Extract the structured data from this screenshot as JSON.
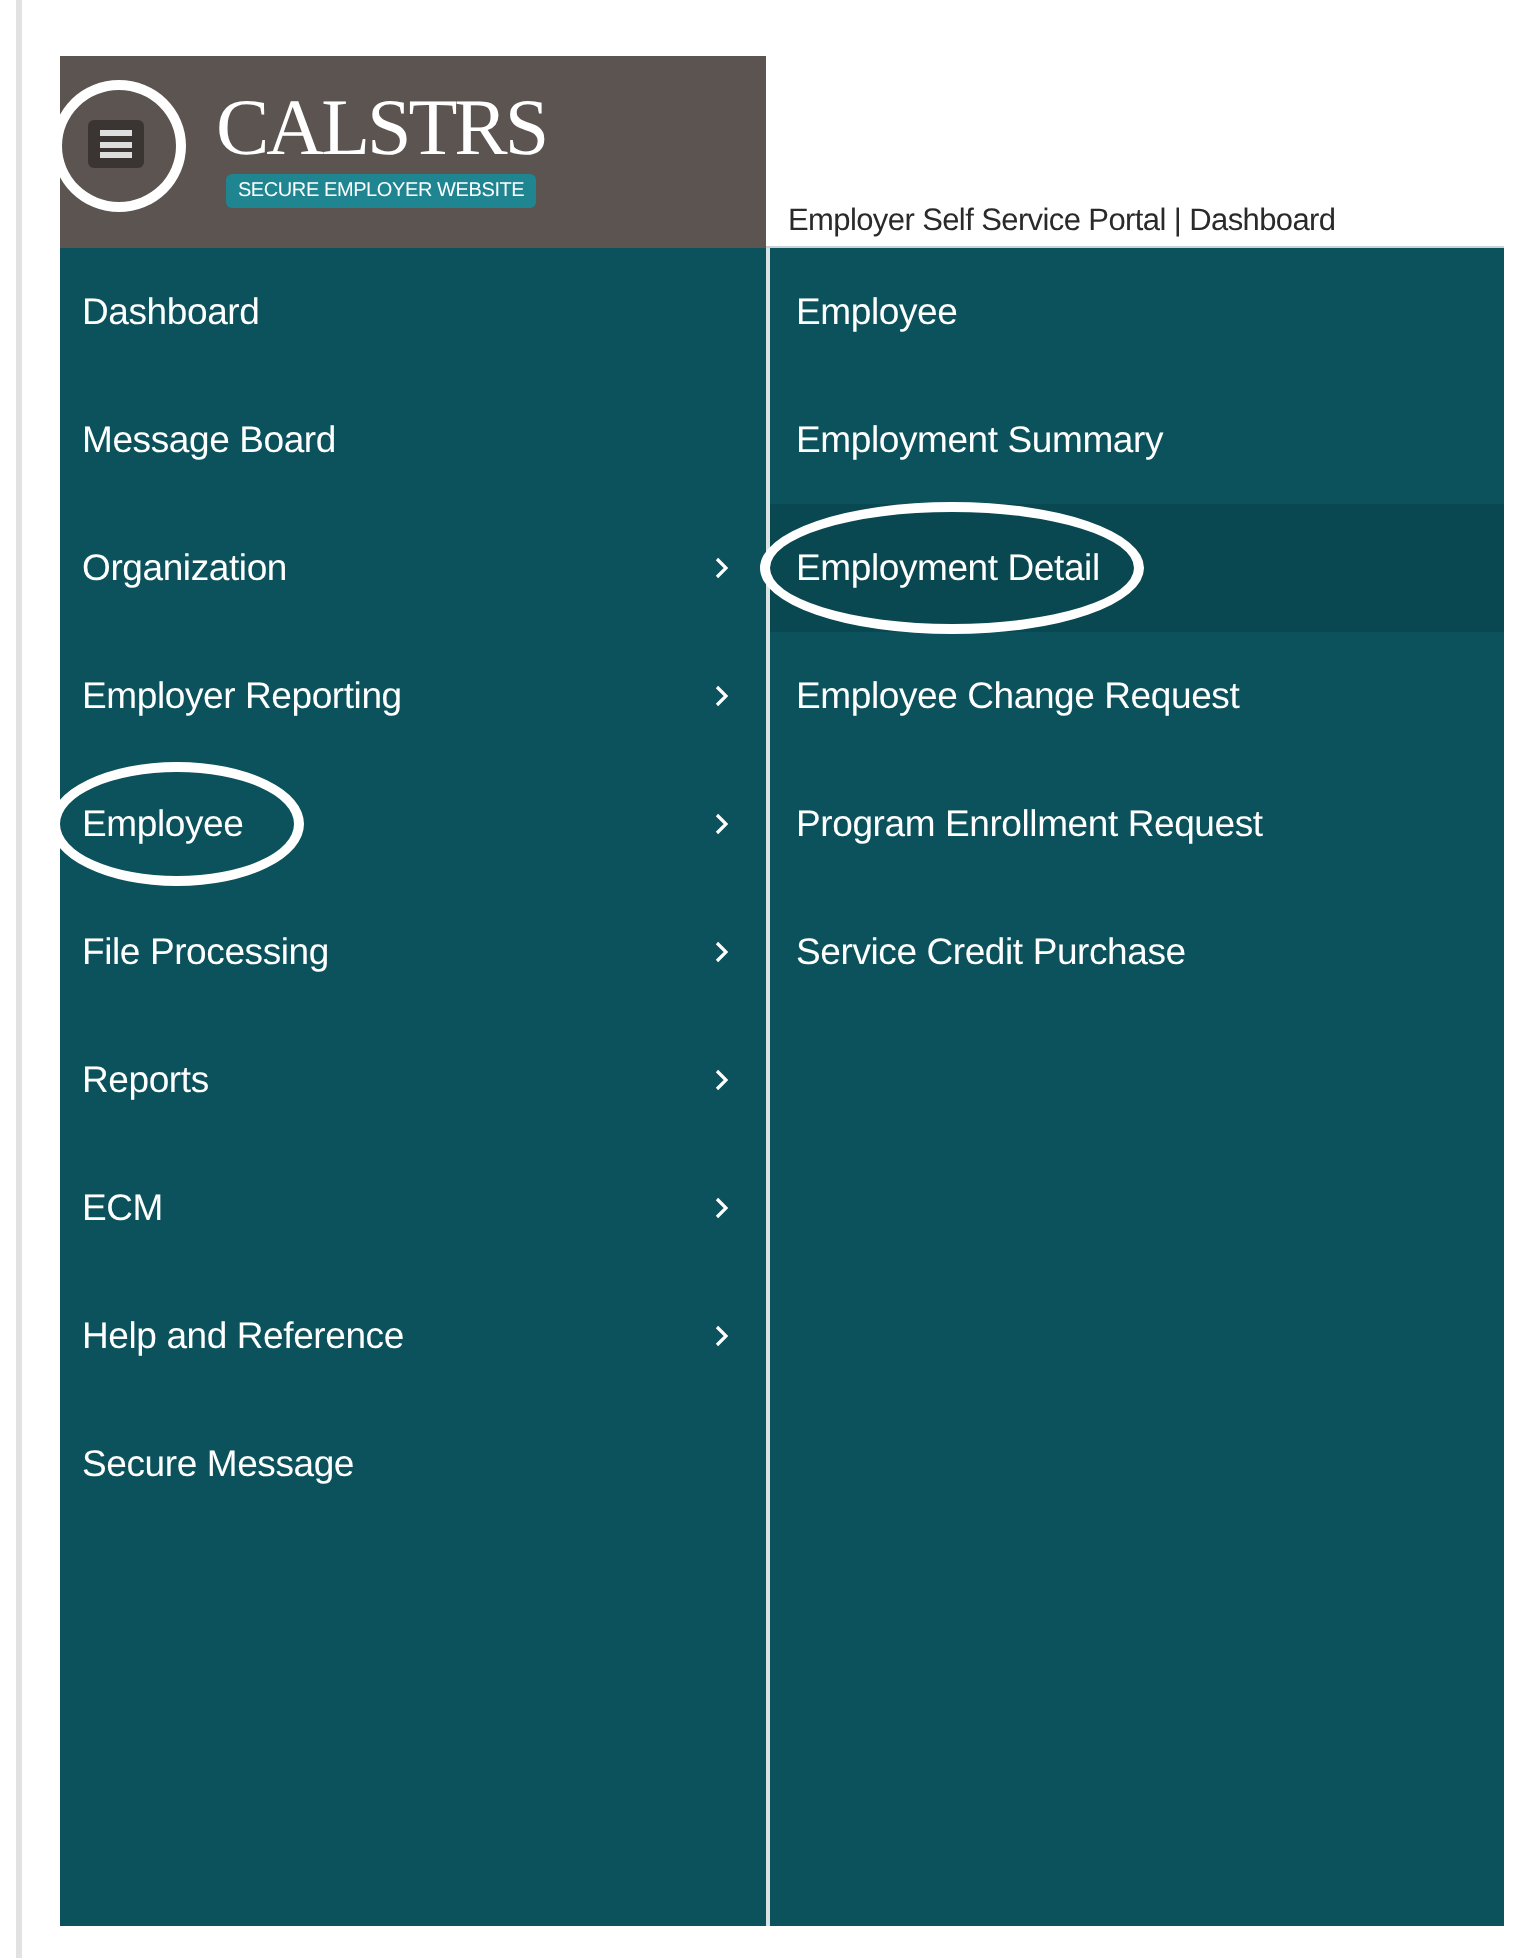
{
  "header": {
    "menu_button": {
      "circled": true
    },
    "logo": {
      "name": "CALSTRS",
      "tagline": "SECURE EMPLOYER WEBSITE"
    },
    "breadcrumb": "Employer Self Service Portal | Dashboard"
  },
  "main_menu": [
    {
      "label": "Dashboard",
      "has_submenu": false,
      "selected": false,
      "circled": false
    },
    {
      "label": "Message Board",
      "has_submenu": false,
      "selected": false,
      "circled": false
    },
    {
      "label": "Organization",
      "has_submenu": true,
      "selected": false,
      "circled": false
    },
    {
      "label": "Employer Reporting",
      "has_submenu": true,
      "selected": false,
      "circled": false
    },
    {
      "label": "Employee",
      "has_submenu": true,
      "selected": false,
      "circled": true
    },
    {
      "label": "File Processing",
      "has_submenu": true,
      "selected": false,
      "circled": false
    },
    {
      "label": "Reports",
      "has_submenu": true,
      "selected": false,
      "circled": false
    },
    {
      "label": "ECM",
      "has_submenu": true,
      "selected": false,
      "circled": false
    },
    {
      "label": "Help and Reference",
      "has_submenu": true,
      "selected": false,
      "circled": false
    },
    {
      "label": "Secure Message",
      "has_submenu": false,
      "selected": false,
      "circled": false
    }
  ],
  "submenu": [
    {
      "label": "Employee",
      "selected": false,
      "circled": false
    },
    {
      "label": "Employment Summary",
      "selected": false,
      "circled": false
    },
    {
      "label": "Employment Detail",
      "selected": true,
      "circled": true
    },
    {
      "label": "Employee Change Request",
      "selected": false,
      "circled": false
    },
    {
      "label": "Program Enrollment Request",
      "selected": false,
      "circled": false
    },
    {
      "label": "Service Credit Purchase",
      "selected": false,
      "circled": false
    }
  ]
}
